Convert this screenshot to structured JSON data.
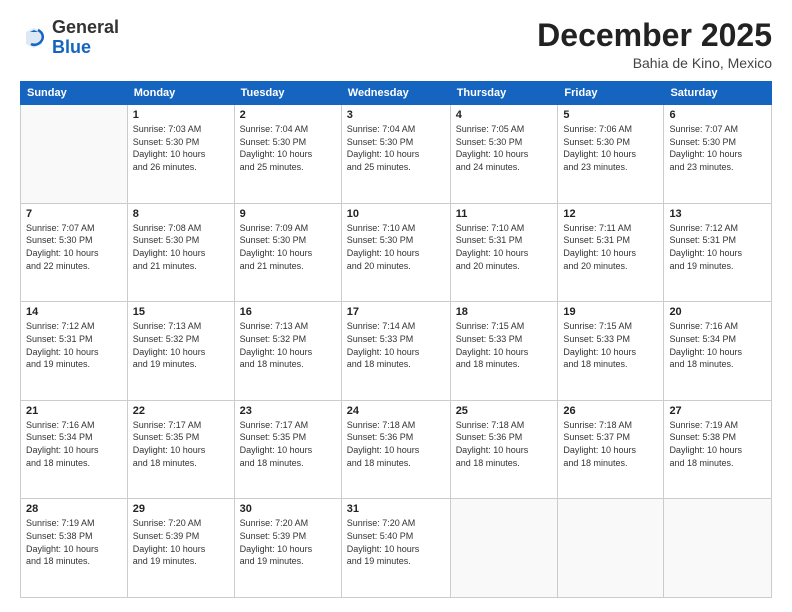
{
  "logo": {
    "general": "General",
    "blue": "Blue"
  },
  "header": {
    "month": "December 2025",
    "location": "Bahia de Kino, Mexico"
  },
  "days_of_week": [
    "Sunday",
    "Monday",
    "Tuesday",
    "Wednesday",
    "Thursday",
    "Friday",
    "Saturday"
  ],
  "weeks": [
    [
      {
        "day": "",
        "info": ""
      },
      {
        "day": "1",
        "info": "Sunrise: 7:03 AM\nSunset: 5:30 PM\nDaylight: 10 hours\nand 26 minutes."
      },
      {
        "day": "2",
        "info": "Sunrise: 7:04 AM\nSunset: 5:30 PM\nDaylight: 10 hours\nand 25 minutes."
      },
      {
        "day": "3",
        "info": "Sunrise: 7:04 AM\nSunset: 5:30 PM\nDaylight: 10 hours\nand 25 minutes."
      },
      {
        "day": "4",
        "info": "Sunrise: 7:05 AM\nSunset: 5:30 PM\nDaylight: 10 hours\nand 24 minutes."
      },
      {
        "day": "5",
        "info": "Sunrise: 7:06 AM\nSunset: 5:30 PM\nDaylight: 10 hours\nand 23 minutes."
      },
      {
        "day": "6",
        "info": "Sunrise: 7:07 AM\nSunset: 5:30 PM\nDaylight: 10 hours\nand 23 minutes."
      }
    ],
    [
      {
        "day": "7",
        "info": "Sunrise: 7:07 AM\nSunset: 5:30 PM\nDaylight: 10 hours\nand 22 minutes."
      },
      {
        "day": "8",
        "info": "Sunrise: 7:08 AM\nSunset: 5:30 PM\nDaylight: 10 hours\nand 21 minutes."
      },
      {
        "day": "9",
        "info": "Sunrise: 7:09 AM\nSunset: 5:30 PM\nDaylight: 10 hours\nand 21 minutes."
      },
      {
        "day": "10",
        "info": "Sunrise: 7:10 AM\nSunset: 5:30 PM\nDaylight: 10 hours\nand 20 minutes."
      },
      {
        "day": "11",
        "info": "Sunrise: 7:10 AM\nSunset: 5:31 PM\nDaylight: 10 hours\nand 20 minutes."
      },
      {
        "day": "12",
        "info": "Sunrise: 7:11 AM\nSunset: 5:31 PM\nDaylight: 10 hours\nand 20 minutes."
      },
      {
        "day": "13",
        "info": "Sunrise: 7:12 AM\nSunset: 5:31 PM\nDaylight: 10 hours\nand 19 minutes."
      }
    ],
    [
      {
        "day": "14",
        "info": "Sunrise: 7:12 AM\nSunset: 5:31 PM\nDaylight: 10 hours\nand 19 minutes."
      },
      {
        "day": "15",
        "info": "Sunrise: 7:13 AM\nSunset: 5:32 PM\nDaylight: 10 hours\nand 19 minutes."
      },
      {
        "day": "16",
        "info": "Sunrise: 7:13 AM\nSunset: 5:32 PM\nDaylight: 10 hours\nand 18 minutes."
      },
      {
        "day": "17",
        "info": "Sunrise: 7:14 AM\nSunset: 5:33 PM\nDaylight: 10 hours\nand 18 minutes."
      },
      {
        "day": "18",
        "info": "Sunrise: 7:15 AM\nSunset: 5:33 PM\nDaylight: 10 hours\nand 18 minutes."
      },
      {
        "day": "19",
        "info": "Sunrise: 7:15 AM\nSunset: 5:33 PM\nDaylight: 10 hours\nand 18 minutes."
      },
      {
        "day": "20",
        "info": "Sunrise: 7:16 AM\nSunset: 5:34 PM\nDaylight: 10 hours\nand 18 minutes."
      }
    ],
    [
      {
        "day": "21",
        "info": "Sunrise: 7:16 AM\nSunset: 5:34 PM\nDaylight: 10 hours\nand 18 minutes."
      },
      {
        "day": "22",
        "info": "Sunrise: 7:17 AM\nSunset: 5:35 PM\nDaylight: 10 hours\nand 18 minutes."
      },
      {
        "day": "23",
        "info": "Sunrise: 7:17 AM\nSunset: 5:35 PM\nDaylight: 10 hours\nand 18 minutes."
      },
      {
        "day": "24",
        "info": "Sunrise: 7:18 AM\nSunset: 5:36 PM\nDaylight: 10 hours\nand 18 minutes."
      },
      {
        "day": "25",
        "info": "Sunrise: 7:18 AM\nSunset: 5:36 PM\nDaylight: 10 hours\nand 18 minutes."
      },
      {
        "day": "26",
        "info": "Sunrise: 7:18 AM\nSunset: 5:37 PM\nDaylight: 10 hours\nand 18 minutes."
      },
      {
        "day": "27",
        "info": "Sunrise: 7:19 AM\nSunset: 5:38 PM\nDaylight: 10 hours\nand 18 minutes."
      }
    ],
    [
      {
        "day": "28",
        "info": "Sunrise: 7:19 AM\nSunset: 5:38 PM\nDaylight: 10 hours\nand 18 minutes."
      },
      {
        "day": "29",
        "info": "Sunrise: 7:20 AM\nSunset: 5:39 PM\nDaylight: 10 hours\nand 19 minutes."
      },
      {
        "day": "30",
        "info": "Sunrise: 7:20 AM\nSunset: 5:39 PM\nDaylight: 10 hours\nand 19 minutes."
      },
      {
        "day": "31",
        "info": "Sunrise: 7:20 AM\nSunset: 5:40 PM\nDaylight: 10 hours\nand 19 minutes."
      },
      {
        "day": "",
        "info": ""
      },
      {
        "day": "",
        "info": ""
      },
      {
        "day": "",
        "info": ""
      }
    ]
  ]
}
